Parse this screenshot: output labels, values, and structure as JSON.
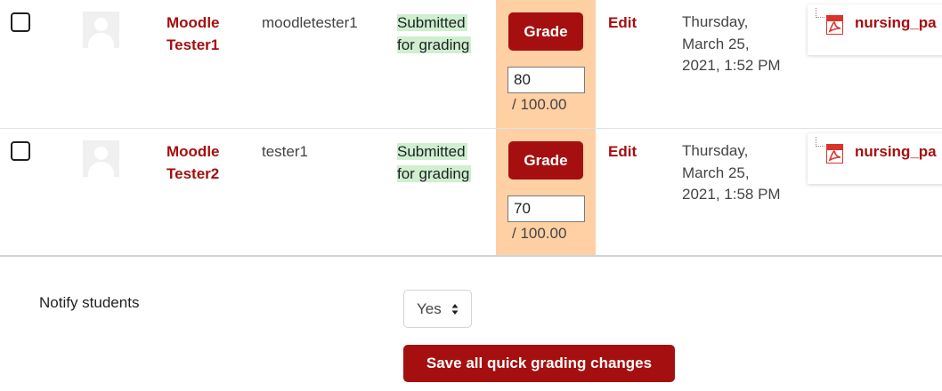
{
  "submissions": [
    {
      "name": "Moodle Tester1",
      "username": "moodletester1",
      "status": "Submitted for grading",
      "grade_button": "Grade",
      "grade_value": "80",
      "grade_max": "/ 100.00",
      "edit": "Edit",
      "last_modified": "Thursday, March 25, 2021, 1:52 PM",
      "file": "nursing_pa"
    },
    {
      "name": "Moodle Tester2",
      "username": "tester1",
      "status": "Submitted for grading",
      "grade_button": "Grade",
      "grade_value": "70",
      "grade_max": "/ 100.00",
      "edit": "Edit",
      "last_modified": "Thursday, March 25, 2021, 1:58 PM",
      "file": "nursing_pa"
    }
  ],
  "notify": {
    "label": "Notify students",
    "selected": "Yes"
  },
  "save_button": "Save all quick grading changes",
  "colors": {
    "accent": "#a50f0f",
    "grade_column": "#ffd0a3",
    "status_highlight": "#cfefcf"
  },
  "icons": {
    "avatar": "default-user-avatar-icon",
    "file": "pdf-icon",
    "select": "up-down-arrows-icon"
  }
}
